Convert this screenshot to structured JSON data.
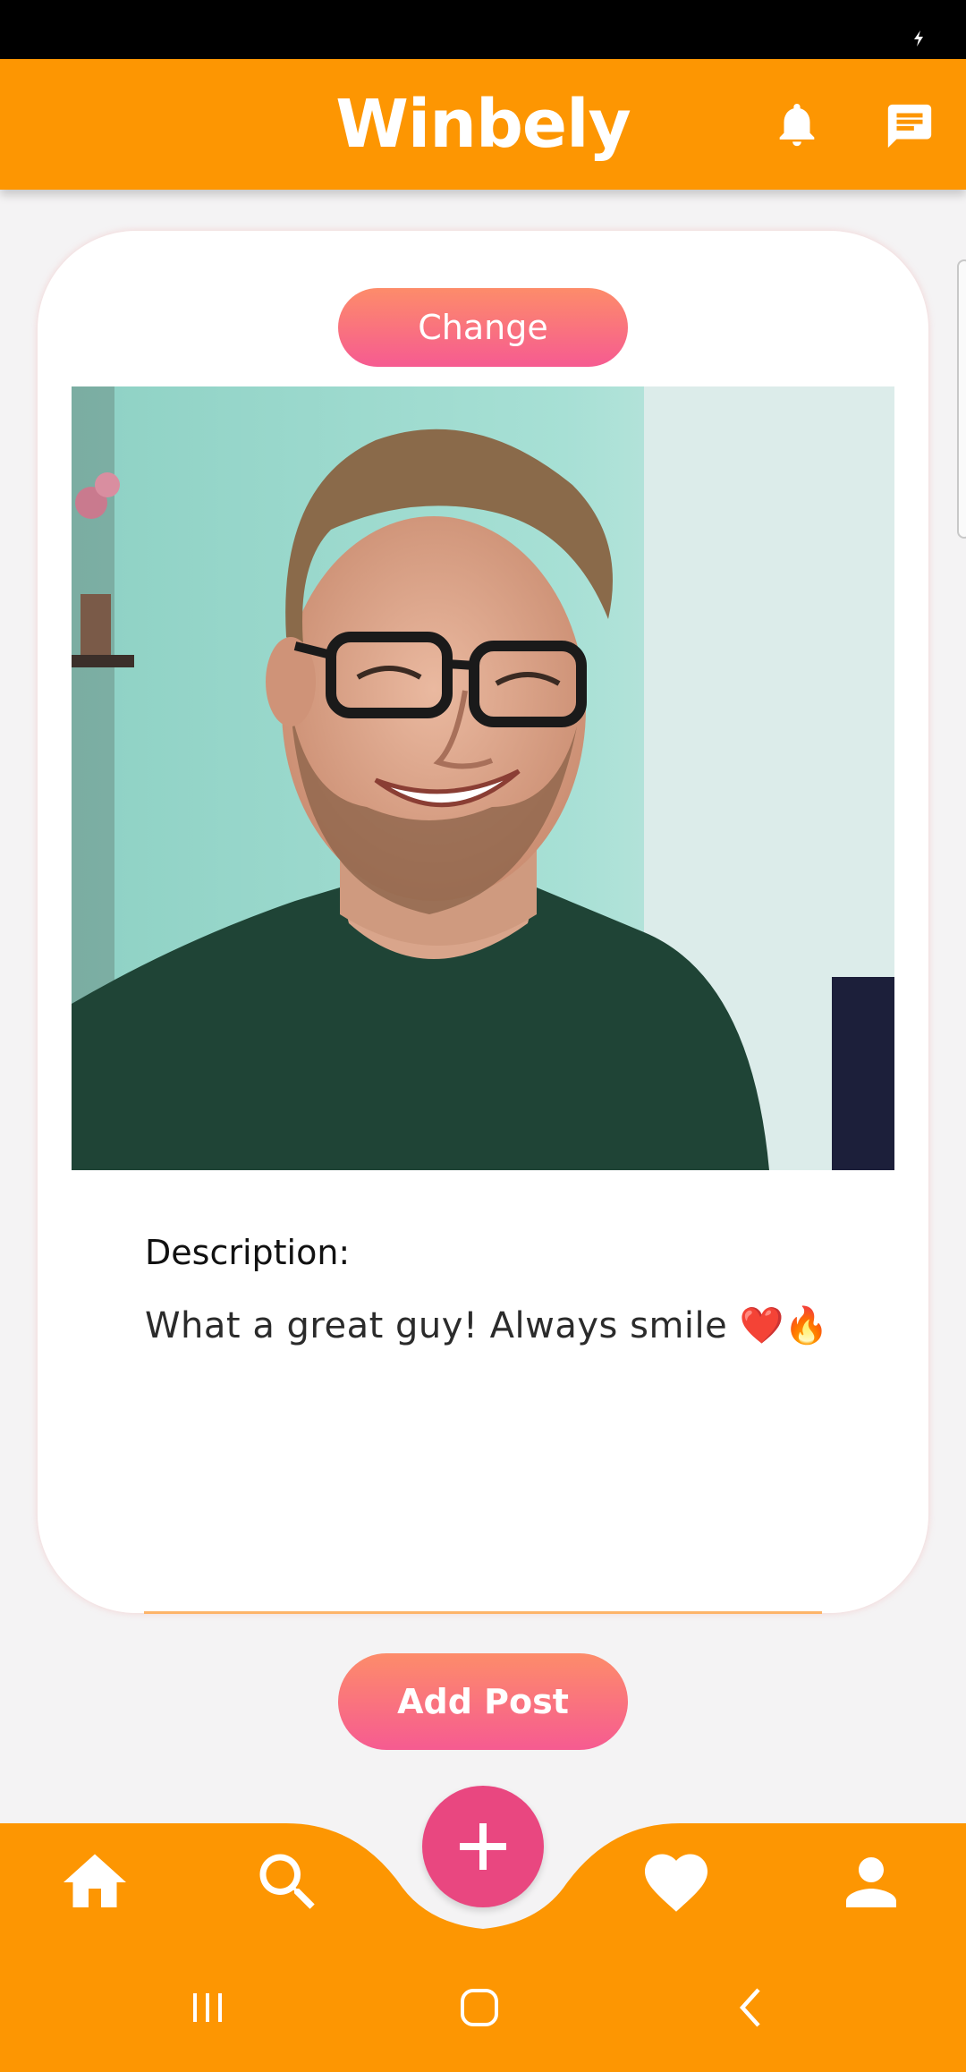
{
  "app": {
    "title": "Winbely"
  },
  "post": {
    "change_label": "Change",
    "description_label": "Description:",
    "description_text": "What a great guy! Always smile ❤️🔥",
    "add_post_label": "Add Post"
  },
  "icons": {
    "header": [
      "bell-icon",
      "chat-icon"
    ],
    "bottom_nav": [
      "home-icon",
      "search-icon",
      "add-icon",
      "heart-icon",
      "profile-icon"
    ],
    "system_nav": [
      "recent-apps-icon",
      "home-circle-icon",
      "back-icon"
    ]
  },
  "colors": {
    "header": "#fd9602",
    "button_gradient_start": "#fd8c6a",
    "button_gradient_end": "#f65b91",
    "fab": "#e94780",
    "background": "#f4f3f4"
  }
}
